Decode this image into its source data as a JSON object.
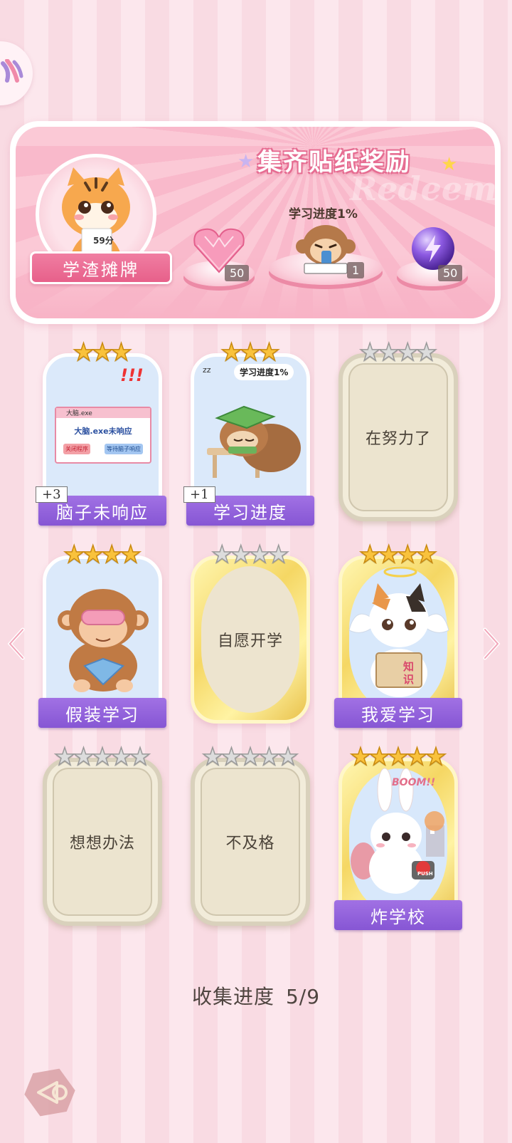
{
  "banner": {
    "title": "集齐贴纸奖励",
    "watermark": "Redeem",
    "character_label": "学渣摊牌",
    "character_paper": "59分",
    "progress_label": "学习进度1%",
    "rewards": [
      {
        "icon": "heart-gem-icon",
        "count": "50"
      },
      {
        "icon": "monkey-sticker-icon",
        "count": "1"
      },
      {
        "icon": "lightning-orb-icon",
        "count": "50"
      }
    ]
  },
  "cards": [
    {
      "name": "脑子未响应",
      "stars_filled": 3,
      "stars_total": 3,
      "state": "unlocked",
      "plus": "+3",
      "art": {
        "window_title": "大脑.exe",
        "window_message": "大脑.exe未响应",
        "btn_close": "关闭程序",
        "btn_wait": "等待脑子响应",
        "exclaim": "!!!"
      }
    },
    {
      "name": "学习进度",
      "stars_filled": 3,
      "stars_total": 3,
      "state": "unlocked",
      "plus": "+1",
      "art": {
        "bubble": "学习进度1%",
        "zz": "zz"
      }
    },
    {
      "name": "在努力了",
      "stars_filled": 0,
      "stars_total": 4,
      "state": "locked"
    },
    {
      "name": "假装学习",
      "stars_filled": 4,
      "stars_total": 4,
      "state": "unlocked"
    },
    {
      "name": "自愿开学",
      "stars_filled": 0,
      "stars_total": 4,
      "state": "locked-gold"
    },
    {
      "name": "我爱学习",
      "stars_filled": 4,
      "stars_total": 4,
      "state": "unlocked-gold",
      "art": {
        "book_text": "知识"
      }
    },
    {
      "name": "想想办法",
      "stars_filled": 0,
      "stars_total": 5,
      "state": "locked"
    },
    {
      "name": "不及格",
      "stars_filled": 0,
      "stars_total": 5,
      "state": "locked"
    },
    {
      "name": "炸学校",
      "stars_filled": 5,
      "stars_total": 5,
      "state": "unlocked-gold",
      "art": {
        "boom": "BOOM!!",
        "push": "PUSH"
      }
    }
  ],
  "progress": {
    "label": "收集进度",
    "value": "5/9"
  },
  "colors": {
    "accent_pink": "#e7608a",
    "banner_purple": "#8656d4",
    "star_gold": "#f9c23c"
  }
}
